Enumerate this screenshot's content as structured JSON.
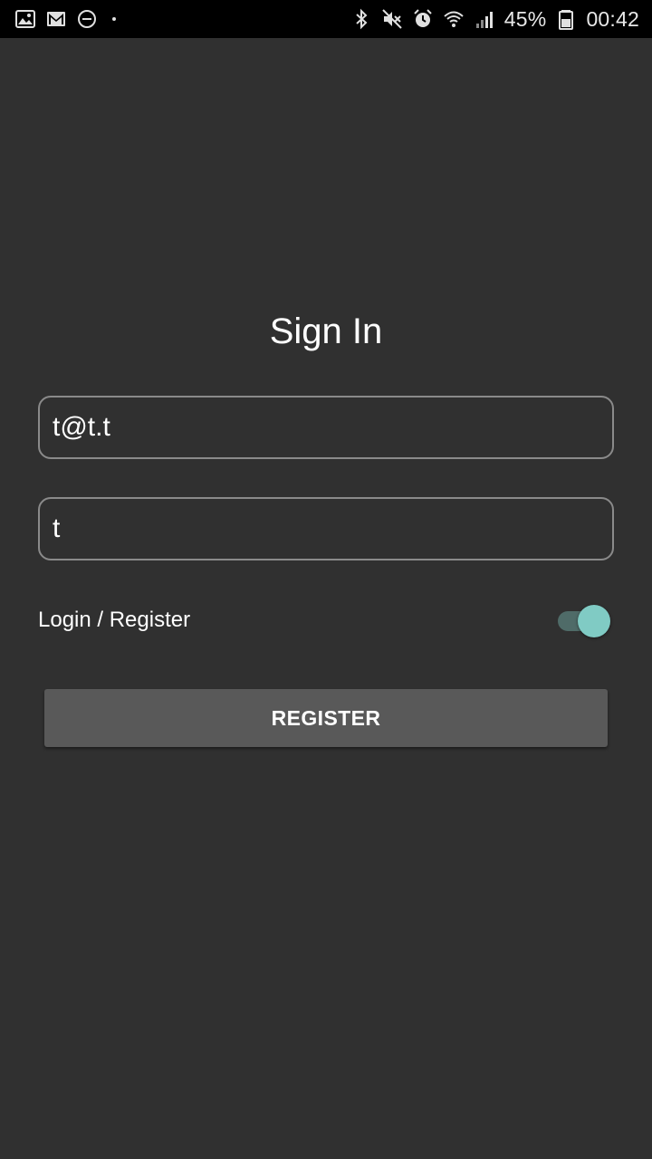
{
  "status_bar": {
    "left_icons": [
      "image-icon",
      "gmail-icon",
      "do-not-disturb-icon",
      "dot-icon"
    ],
    "right_icons": [
      "bluetooth-icon",
      "mute-icon",
      "alarm-icon",
      "wifi-icon",
      "signal-icon",
      "battery-icon"
    ],
    "battery_percent": "45%",
    "time": "00:42"
  },
  "page": {
    "title": "Sign In"
  },
  "form": {
    "email_value": "t@t.t",
    "password_value": "t",
    "toggle_label": "Login / Register",
    "toggle_on": true,
    "register_label": "REGISTER"
  },
  "colors": {
    "background": "#303030",
    "accent": "#80cbc4",
    "button": "#595959"
  }
}
